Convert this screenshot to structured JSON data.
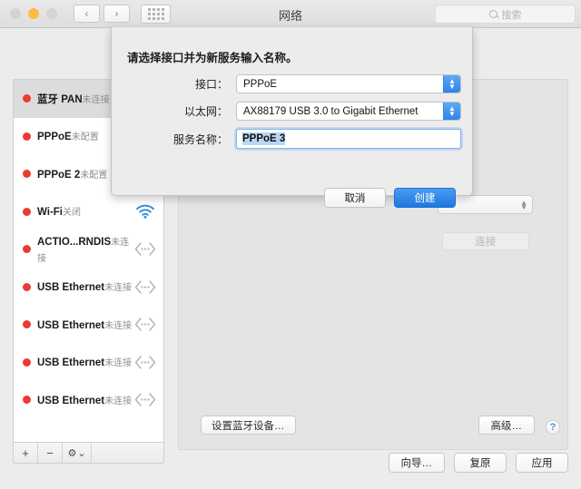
{
  "titlebar": {
    "title": "网络",
    "traffic_lights": [
      "close",
      "minimize",
      "zoom"
    ],
    "back_label": "‹",
    "forward_label": "›",
    "grid_label": "show-all-grid",
    "search_placeholder": "搜索"
  },
  "sidebar": {
    "services": [
      {
        "name": "蓝牙 PAN",
        "status": "未连接",
        "icon": "none",
        "selected": true
      },
      {
        "name": "PPPoE",
        "status": "未配置",
        "icon": "none",
        "selected": false
      },
      {
        "name": "PPPoE 2",
        "status": "未配置",
        "icon": "none",
        "selected": false
      },
      {
        "name": "Wi-Fi",
        "status": "关闭",
        "icon": "wifi",
        "selected": false
      },
      {
        "name": "ACTIO...RNDIS",
        "status": "未连接",
        "icon": "ethernet",
        "selected": false
      },
      {
        "name": "USB Ethernet",
        "status": "未连接",
        "icon": "ethernet",
        "selected": false
      },
      {
        "name": "USB Ethernet",
        "status": "未连接",
        "icon": "ethernet",
        "selected": false
      },
      {
        "name": "USB Ethernet",
        "status": "未连接",
        "icon": "ethernet",
        "selected": false
      },
      {
        "name": "USB Ethernet",
        "status": "未连接",
        "icon": "ethernet",
        "selected": false
      }
    ],
    "toolbar": {
      "add_label": "+",
      "remove_label": "−",
      "gear_label": "⚙",
      "gear_caret": "⌄"
    }
  },
  "detail": {
    "connect_label": "连接",
    "bluetooth_setup_label": "设置蓝牙设备…",
    "advanced_label": "高级…",
    "help_label": "?"
  },
  "bottom": {
    "assistant_label": "向导…",
    "revert_label": "复原",
    "apply_label": "应用"
  },
  "sheet": {
    "title": "请选择接口并为新服务输入名称。",
    "interface_label": "接口：",
    "interface_value": "PPPoE",
    "ethernet_label": "以太网：",
    "ethernet_value": "AX88179 USB 3.0 to Gigabit Ethernet",
    "service_name_label": "服务名称：",
    "service_name_value": "PPPoE 3",
    "cancel_label": "取消",
    "create_label": "创建"
  },
  "colors": {
    "accent": "#2f84e8",
    "status_dot": "#ec3a33",
    "wifi_icon": "#3b8fe0",
    "window_bg": "#ececec"
  }
}
